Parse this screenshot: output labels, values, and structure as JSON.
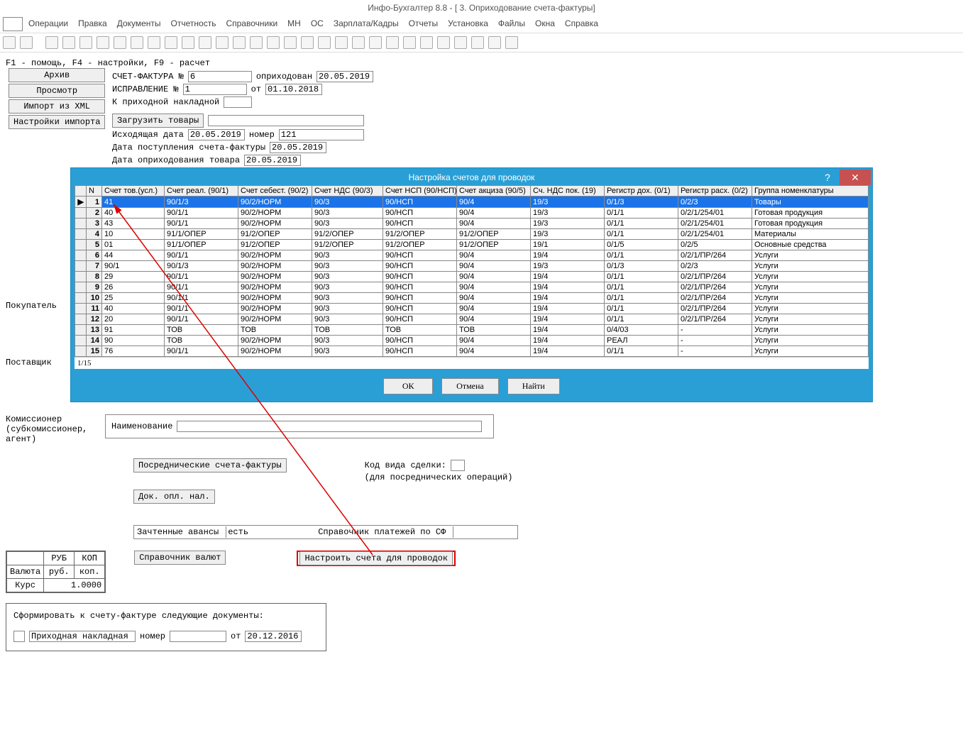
{
  "title": "Инфо-Бухгалтер 8.8 - [  3. Оприходование счета-фактуры]",
  "menu": [
    "Операции",
    "Правка",
    "Документы",
    "Отчетность",
    "Справочники",
    "МН",
    "ОС",
    "Зарплата/Кадры",
    "Отчеты",
    "Установка",
    "Файлы",
    "Окна",
    "Справка"
  ],
  "hint": "F1 - помощь, F4 - настройки, F9 - расчет",
  "leftButtons": {
    "archive": "Архив",
    "preview": "Просмотр",
    "importXml": "Импорт из XML",
    "importSettings": "Настройки импорта"
  },
  "form": {
    "sfLabel": "СЧЕТ-ФАКТУРА №",
    "sfNum": "6",
    "sfPostedLbl": "оприходован",
    "sfPostedDate": "20.05.2019",
    "corrLabel": "ИСПРАВЛЕНИЕ  №",
    "corrNum": "1",
    "corrFromLbl": "от",
    "corrFromDate": "01.10.2018",
    "toInvoiceLbl": "К приходной накладной",
    "toInvoice": "",
    "loadGoods": "Загрузить товары",
    "outDateLbl": "Исходящая дата",
    "outDate": "20.05.2019",
    "outNumLbl": "номер",
    "outNum": "121",
    "sfRecvLbl": "Дата поступления счета-фактуры",
    "sfRecvDate": "20.05.2019",
    "goodsDateLbl": "Дата оприходования товара",
    "goodsDate": "20.05.2019",
    "buyerLbl": "Покупатель",
    "supplierLbl": "Поставщик",
    "commLbl": "Комиссионер\n(субкомиссионер,\nагент)",
    "nameLbl": "Наименование",
    "nameVal": "",
    "intermBtn": "Посреднические счета-фактуры",
    "dealCodeLbl": "Код вида сделки:",
    "dealHint": "(для посреднических операций)",
    "docPayBtn": "Док. опл. нал.",
    "advLbl": "Зачтенные авансы",
    "advVal": "есть",
    "payRefLbl": "Справочник платежей по СФ",
    "curRefBtn": "Справочник валют",
    "cfgAcctBtn": "Настроить счета для проводок",
    "currency": {
      "hdrRub": "РУБ",
      "hdrKop": "КОП",
      "valLbl": "Валюта",
      "valRub": "руб.",
      "valKop": "коп.",
      "rateLbl": "Курс",
      "rate": "1.0000"
    },
    "docGen": "Сформировать к счету-фактуре следующие документы:",
    "docKind": "Приходная накладная",
    "docNumLbl": "номер",
    "docNum": "",
    "docFromLbl": "от",
    "docFrom": "20.12.2016"
  },
  "dialog": {
    "title": "Настройка счетов для проводок",
    "status": "1/15",
    "ok": "ОК",
    "cancel": "Отмена",
    "find": "Найти",
    "headers": [
      "",
      "N",
      "Счет тов.(усл.)",
      "Счет реал. (90/1)",
      "Счет себест. (90/2)",
      "Счет НДС (90/3)",
      "Счет НСП (90/НСП)",
      "Счет акциза (90/5)",
      "Сч. НДС пок. (19)",
      "Регистр дох. (0/1)",
      "Регистр расх. (0/2)",
      "Группа номенклатуры"
    ],
    "rows": [
      {
        "n": "1",
        "c": [
          "41",
          "90/1/3",
          "90/2/НОРМ",
          "90/3",
          "90/НСП",
          "90/4",
          "19/3",
          "0/1/3",
          "0/2/3",
          "Товары"
        ],
        "sel": true
      },
      {
        "n": "2",
        "c": [
          "40",
          "90/1/1",
          "90/2/НОРМ",
          "90/3",
          "90/НСП",
          "90/4",
          "19/3",
          "0/1/1",
          "0/2/1/254/01",
          "Готовая продукция"
        ]
      },
      {
        "n": "3",
        "c": [
          "43",
          "90/1/1",
          "90/2/НОРМ",
          "90/3",
          "90/НСП",
          "90/4",
          "19/3",
          "0/1/1",
          "0/2/1/254/01",
          "Готовая продукция"
        ]
      },
      {
        "n": "4",
        "c": [
          "10",
          "91/1/ОПЕР",
          "91/2/ОПЕР",
          "91/2/ОПЕР",
          "91/2/ОПЕР",
          "91/2/ОПЕР",
          "19/3",
          "0/1/1",
          "0/2/1/254/01",
          "Материалы"
        ]
      },
      {
        "n": "5",
        "c": [
          "01",
          "91/1/ОПЕР",
          "91/2/ОПЕР",
          "91/2/ОПЕР",
          "91/2/ОПЕР",
          "91/2/ОПЕР",
          "19/1",
          "0/1/5",
          "0/2/5",
          "Основные средства"
        ]
      },
      {
        "n": "6",
        "c": [
          "44",
          "90/1/1",
          "90/2/НОРМ",
          "90/3",
          "90/НСП",
          "90/4",
          "19/4",
          "0/1/1",
          "0/2/1/ПР/264",
          "Услуги"
        ]
      },
      {
        "n": "7",
        "c": [
          "90/1",
          "90/1/3",
          "90/2/НОРМ",
          "90/3",
          "90/НСП",
          "90/4",
          "19/3",
          "0/1/3",
          "0/2/3",
          "Услуги"
        ]
      },
      {
        "n": "8",
        "c": [
          "29",
          "90/1/1",
          "90/2/НОРМ",
          "90/3",
          "90/НСП",
          "90/4",
          "19/4",
          "0/1/1",
          "0/2/1/ПР/264",
          "Услуги"
        ]
      },
      {
        "n": "9",
        "c": [
          "26",
          "90/1/1",
          "90/2/НОРМ",
          "90/3",
          "90/НСП",
          "90/4",
          "19/4",
          "0/1/1",
          "0/2/1/ПР/264",
          "Услуги"
        ]
      },
      {
        "n": "10",
        "c": [
          "25",
          "90/1/1",
          "90/2/НОРМ",
          "90/3",
          "90/НСП",
          "90/4",
          "19/4",
          "0/1/1",
          "0/2/1/ПР/264",
          "Услуги"
        ]
      },
      {
        "n": "11",
        "c": [
          "40",
          "90/1/1",
          "90/2/НОРМ",
          "90/3",
          "90/НСП",
          "90/4",
          "19/4",
          "0/1/1",
          "0/2/1/ПР/264",
          "Услуги"
        ]
      },
      {
        "n": "12",
        "c": [
          "20",
          "90/1/1",
          "90/2/НОРМ",
          "90/3",
          "90/НСП",
          "90/4",
          "19/4",
          "0/1/1",
          "0/2/1/ПР/264",
          "Услуги"
        ]
      },
      {
        "n": "13",
        "c": [
          "91",
          "ТОВ",
          "ТОВ",
          "ТОВ",
          "ТОВ",
          "ТОВ",
          "19/4",
          "0/4/03",
          "-",
          "Услуги"
        ]
      },
      {
        "n": "14",
        "c": [
          "90",
          "ТОВ",
          "90/2/НОРМ",
          "90/3",
          "90/НСП",
          "90/4",
          "19/4",
          "РЕАЛ",
          "-",
          "Услуги"
        ]
      },
      {
        "n": "15",
        "c": [
          "76",
          "90/1/1",
          "90/2/НОРМ",
          "90/3",
          "90/НСП",
          "90/4",
          "19/4",
          "0/1/1",
          "-",
          "Услуги"
        ]
      }
    ]
  }
}
